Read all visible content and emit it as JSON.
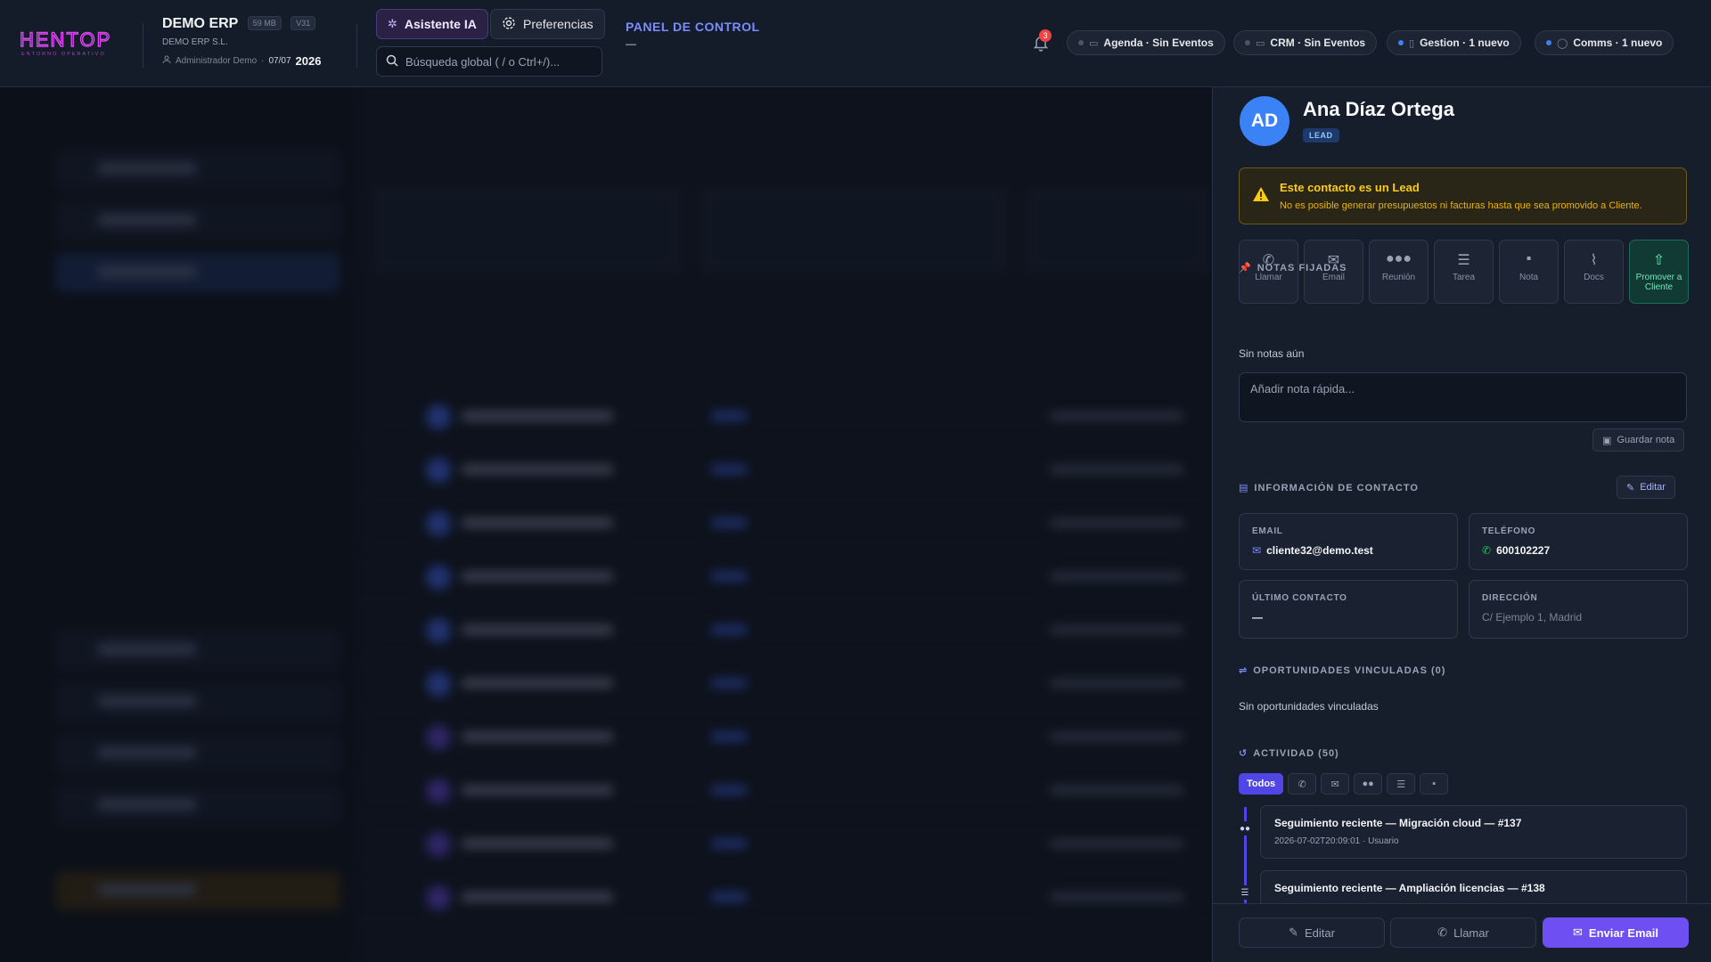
{
  "brand": {
    "logo_text": "HENTOP",
    "logo_sub": "ENTORNO OPERATIVO",
    "accent": "#d946ef"
  },
  "company": {
    "name": "DEMO ERP",
    "storage": "59 MB",
    "version": "V31",
    "legal_name": "DEMO ERP S.L.",
    "user": "Administrador Demo",
    "date": "07/07",
    "year": "2026"
  },
  "topbar": {
    "ai_button": "Asistente IA",
    "prefs_button": "Preferencias",
    "search_placeholder": "Búsqueda global ( / o Ctrl+/)...",
    "panel_title": "PANEL DE CONTROL",
    "panel_sub": "—",
    "notifications_count": "3",
    "pills": [
      {
        "label": "Agenda · Sin Eventos",
        "status": "idle"
      },
      {
        "label": "CRM · Sin Eventos",
        "status": "idle"
      },
      {
        "label": "Gestion · 1 nuevo",
        "status": "new"
      },
      {
        "label": "Comms · 1 nuevo",
        "status": "new"
      }
    ]
  },
  "contact": {
    "initials": "AD",
    "name": "Ana Díaz Ortega",
    "badge": "LEAD",
    "alert_title": "Este contacto es un Lead",
    "alert_desc": "No es posible generar presupuestos ni facturas hasta que sea promovido a Cliente.",
    "actions": [
      {
        "label": "Llamar",
        "icon": "phone-icon"
      },
      {
        "label": "Email",
        "icon": "mail-icon"
      },
      {
        "label": "Reunión",
        "icon": "users-icon"
      },
      {
        "label": "Tarea",
        "icon": "tasks-icon"
      },
      {
        "label": "Nota",
        "icon": "note-icon"
      },
      {
        "label": "Docs",
        "icon": "paperclip-icon"
      },
      {
        "label": "Promover a Cliente",
        "icon": "arrow-up-icon"
      }
    ],
    "pinned": {
      "title": "NOTAS FIJADAS",
      "empty": "Sin notas aún",
      "placeholder": "Añadir nota rápida...",
      "save": "Guardar nota"
    },
    "info": {
      "title": "INFORMACIÓN DE CONTACTO",
      "edit": "Editar",
      "email_label": "EMAIL",
      "email": "cliente32@demo.test",
      "phone_label": "TELÉFONO",
      "phone": "600102227",
      "last_label": "ÚLTIMO CONTACTO",
      "last": "—",
      "address_label": "DIRECCIÓN",
      "address": "C/ Ejemplo 1, Madrid"
    },
    "opps": {
      "title": "OPORTUNIDADES VINCULADAS (0)",
      "empty": "Sin oportunidades vinculadas"
    },
    "activity": {
      "title": "ACTIVIDAD (50)",
      "filter_all": "Todos",
      "items": [
        {
          "title": "Seguimiento reciente — Migración cloud — #137",
          "meta": "2026-07-02T20:09:01 · Usuario"
        },
        {
          "title": "Seguimiento reciente — Ampliación licencias — #138",
          "meta": ""
        }
      ]
    }
  },
  "footer": {
    "edit": "Editar",
    "call": "Llamar",
    "email": "Enviar Email"
  }
}
